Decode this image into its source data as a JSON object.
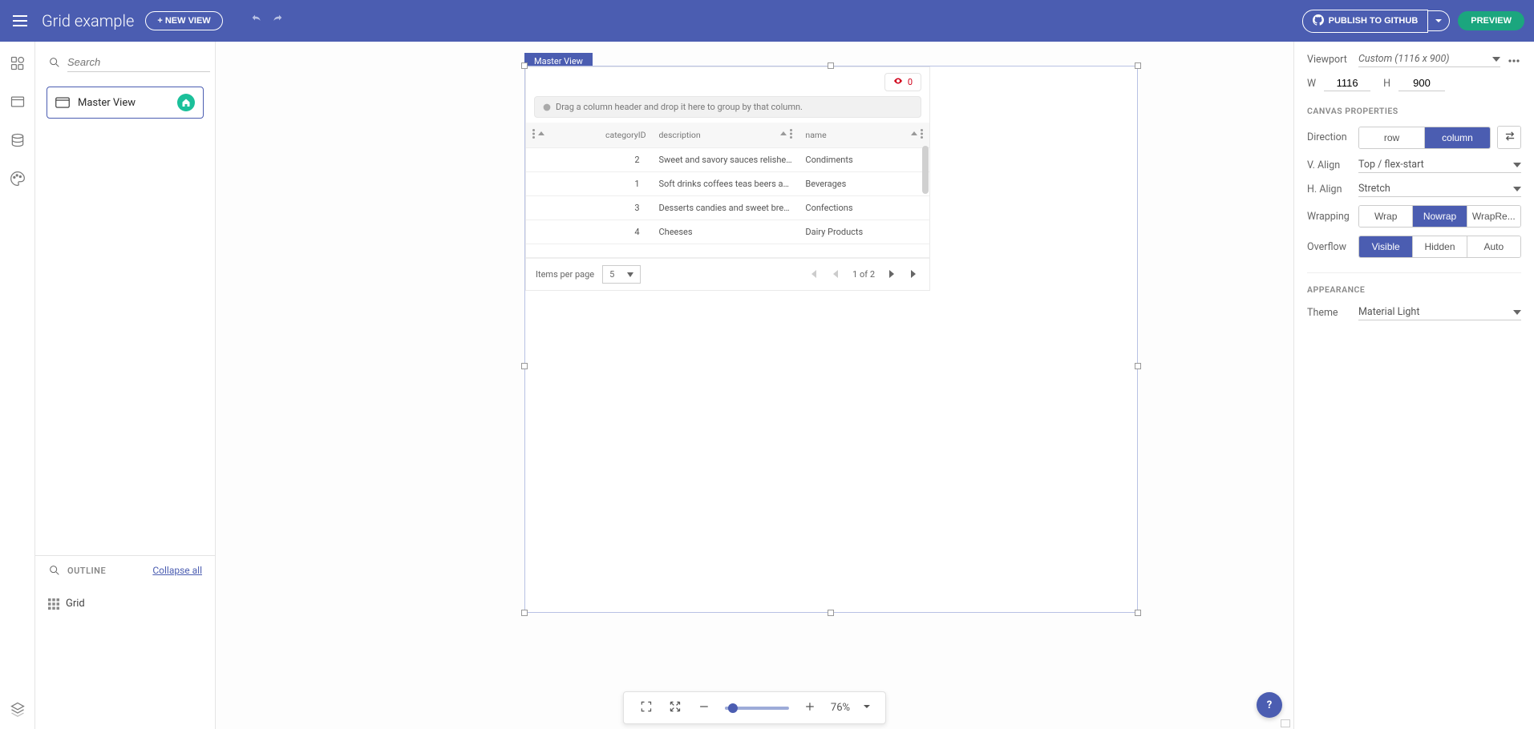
{
  "header": {
    "title": "Grid example",
    "new_view": "+ NEW VIEW",
    "publish": "PUBLISH TO GITHUB",
    "preview": "PREVIEW"
  },
  "left": {
    "search_placeholder": "Search",
    "view_item": "Master View",
    "outline_title": "OUTLINE",
    "collapse_all": "Collapse all",
    "outline_item": "Grid"
  },
  "canvas": {
    "tab_label": "Master View",
    "grid": {
      "views_count": "0",
      "group_hint": "Drag a column header and drop it here to group by that column.",
      "columns": {
        "id": "categoryID",
        "desc": "description",
        "name": "name"
      },
      "rows": [
        {
          "id": "2",
          "desc": "Sweet and savory sauces relishes sp...",
          "name": "Condiments"
        },
        {
          "id": "1",
          "desc": "Soft drinks coffees teas beers and al...",
          "name": "Beverages"
        },
        {
          "id": "3",
          "desc": "Desserts candies and sweet breads",
          "name": "Confections"
        },
        {
          "id": "4",
          "desc": "Cheeses",
          "name": "Dairy Products"
        }
      ],
      "pager": {
        "items_per_page": "Items per page",
        "size": "5",
        "info": "1 of 2"
      }
    },
    "zoom": {
      "pct": "76%"
    }
  },
  "right": {
    "viewport_label": "Viewport",
    "viewport_value": "Custom (1116 x 900)",
    "w_label": "W",
    "w_value": "1116",
    "h_label": "H",
    "h_value": "900",
    "section_canvas": "CANVAS PROPERTIES",
    "direction_label": "Direction",
    "direction_row": "row",
    "direction_column": "column",
    "valign_label": "V. Align",
    "valign_value": "Top / flex-start",
    "halign_label": "H. Align",
    "halign_value": "Stretch",
    "wrapping_label": "Wrapping",
    "wrap": "Wrap",
    "nowrap": "Nowrap",
    "wrapre": "WrapRe...",
    "overflow_label": "Overflow",
    "ov_visible": "Visible",
    "ov_hidden": "Hidden",
    "ov_auto": "Auto",
    "section_appearance": "APPEARANCE",
    "theme_label": "Theme",
    "theme_value": "Material Light"
  }
}
